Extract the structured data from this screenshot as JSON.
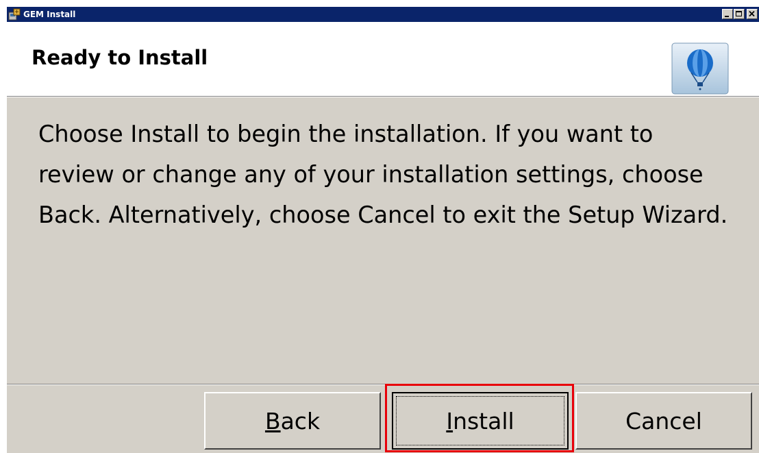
{
  "window": {
    "title": "GEM Install",
    "controls": [
      "minimize",
      "maximize",
      "close"
    ]
  },
  "header": {
    "title": "Ready to Install",
    "logo_icon": "hot-air-balloon-icon"
  },
  "body": {
    "text": "Choose Install to begin the installation. If you want to review or change any of your installation settings, choose Back. Alternatively, choose Cancel to exit the Setup Wizard."
  },
  "buttons": {
    "back": {
      "mnemonic": "B",
      "rest": "ack"
    },
    "install": {
      "mnemonic": "I",
      "rest": "nstall"
    },
    "cancel": {
      "label": "Cancel"
    }
  },
  "colors": {
    "titlebar": "#0a246a",
    "dialog_face": "#d4d0c8",
    "highlight": "#e8000a"
  }
}
